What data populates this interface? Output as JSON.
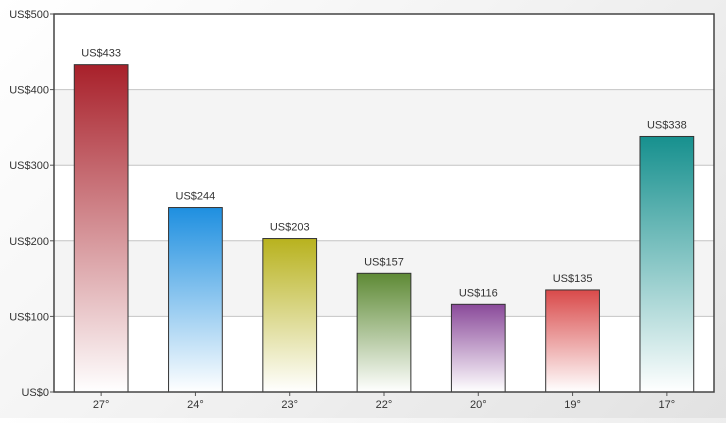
{
  "chart_data": {
    "type": "bar",
    "title": "",
    "xlabel": "",
    "ylabel": "",
    "categories": [
      "27°",
      "24°",
      "23°",
      "22°",
      "20°",
      "19°",
      "17°"
    ],
    "values": [
      433,
      244,
      203,
      157,
      116,
      135,
      338
    ],
    "value_labels": [
      "US$433",
      "US$244",
      "US$203",
      "US$157",
      "US$116",
      "US$135",
      "US$338"
    ],
    "y_ticks": [
      0,
      100,
      200,
      300,
      400,
      500
    ],
    "y_tick_labels": [
      "US$0",
      "US$100",
      "US$200",
      "US$300",
      "US$400",
      "US$500"
    ],
    "ylim": [
      0,
      500
    ],
    "grid": true,
    "legend": "none",
    "bar_colors": [
      "#a8202a",
      "#1e8fe0",
      "#b8b21e",
      "#5e8a35",
      "#8a4a9a",
      "#d94a4a",
      "#16908e"
    ]
  }
}
